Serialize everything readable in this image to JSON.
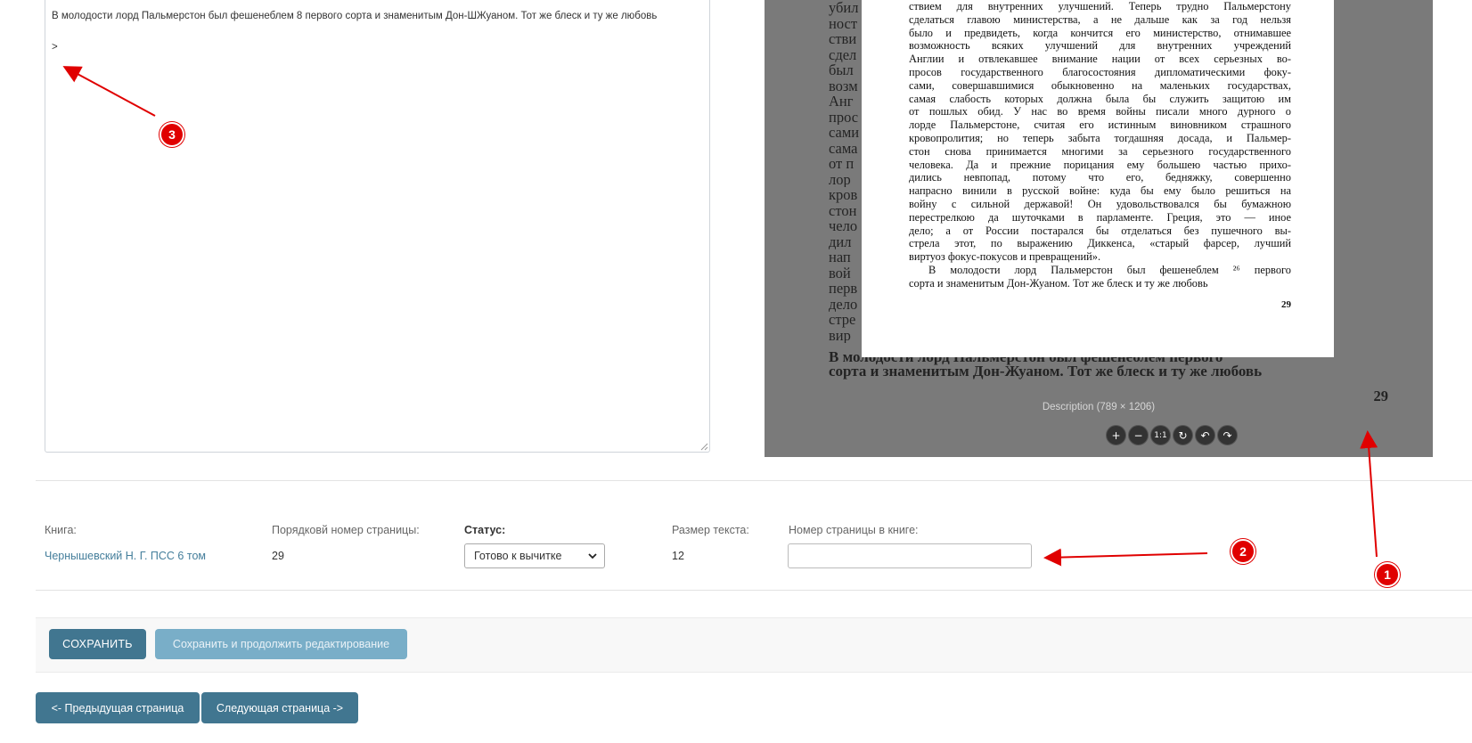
{
  "editor": {
    "line1": "В молодости лорд Пальмерстон был фешенеблем 8 первого сорта и знаменитым Дон-ШЖуаном. Тот же блеск и ту же любовь",
    "line2": ">"
  },
  "viewer": {
    "background_lines": [
      "убил",
      "ност",
      "стви",
      "сдел",
      "был",
      "возм",
      "Анг",
      "прос",
      "сами",
      "сама",
      "от п",
      "лор",
      "кров",
      "стон",
      "чело",
      "дил",
      "нап",
      "вой",
      "перв",
      "дело",
      "стре",
      "вир"
    ],
    "background_bottom1": "В молодости лорд Пальмерстон был фешенеблем первого",
    "background_bottom2": "сорта и знаменитым Дон-Жуаном. Тот же блеск и ту же любовь",
    "background_page_number": "29",
    "scan_lines": [
      "ствием для внутренних улучшений. Теперь трудно Пальмерстону",
      "сделаться главою министерства, а не дальше как за год нельзя",
      "было и предвидеть, когда кончится его министерство, отнимавшее",
      "возможность всяких улучшений для внутренних учреждений",
      "Англии и отвлекавшее внимание нации от всех серьезных во-",
      "просов государственного благосостояния дипломатическими фоку-",
      "сами, совершавшимися обыкновенно на маленьких государствах,",
      "самая слабость которых должна была бы служить защитою им",
      "от пошлых обид. У нас во время войны писали много дурного о",
      "лорде Пальмерстоне, считая его истинным виновником страшного",
      "кровопролития; но теперь забыта тогдашняя досада, и Пальмер-",
      "стон снова принимается многими за серьезного государственного",
      "человека. Да и прежние порицания ему большею частью прихо-",
      "дились невпопад, потому что его, бедняжку, совершенно",
      "напрасно винили в русской войне: куда бы ему было решиться на",
      "войну с сильной державой! Он удовольствовался бы бумажною",
      "перестрелкою да шуточками в парламенте. Греция, это — иное",
      "дело; а от России постарался бы отделаться без пушечного вы-",
      "стрела этот, по выражению Диккенса, «старый фарсер, лучший",
      "виртуоз фокус-покусов и превращений».",
      "В молодости лорд Пальмерстон был фешенеблем ²⁶ первого",
      "сорта и знаменитым Дон-Жуаном. Тот же блеск и ту же любовь"
    ],
    "scan_page_number": "29",
    "caption": "Description (789 × 1206)",
    "tools": [
      "zoom-in-icon",
      "zoom-out-icon",
      "actual-size-icon",
      "reset-icon",
      "rotate-left-icon",
      "rotate-right-icon"
    ],
    "tool_glyphs": [
      "+",
      "−",
      "1:1",
      "↻",
      "↶",
      "↷"
    ]
  },
  "meta": {
    "book_label": "Книга:",
    "book_value": "Чернышевский Н. Г. ПСС 6 том",
    "order_label": "Порядковй номер страницы:",
    "order_value": "29",
    "status_label": "Статус:",
    "status_value": "Готово к вычитке",
    "size_label": "Размер текста:",
    "size_value": "12",
    "page_num_label": "Номер страницы в книге:",
    "page_num_value": ""
  },
  "actions": {
    "save": "СОХРАНИТЬ",
    "save_continue": "Сохранить и продолжить редактирование",
    "prev": "<- Предыдущая страница",
    "next": "Следующая страница ->"
  },
  "annotations": {
    "badge1": "1",
    "badge2": "2",
    "badge3": "3",
    "color": "#e00000"
  },
  "colors": {
    "primary": "#417690",
    "primary_light": "#79aec8",
    "link": "#447e9b",
    "viewer_bg": "#7a7a7a"
  }
}
